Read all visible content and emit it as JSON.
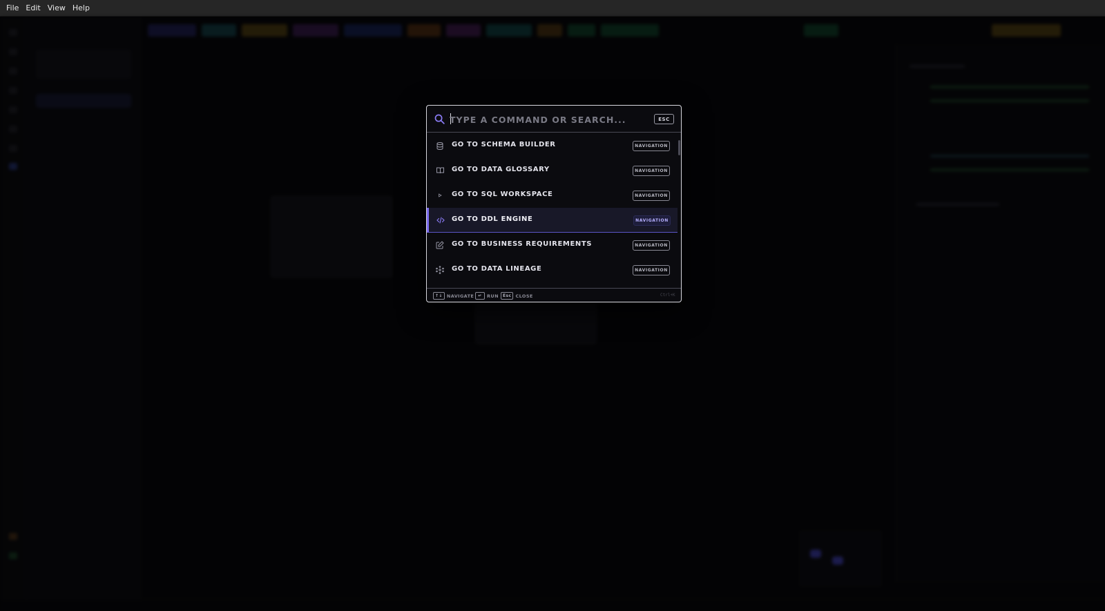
{
  "menubar": {
    "items": [
      "File",
      "Edit",
      "View",
      "Help"
    ]
  },
  "palette": {
    "search_placeholder": "TYPE A COMMAND OR SEARCH...",
    "search_value": "",
    "esc_label": "ESC",
    "active_index": 3,
    "items": [
      {
        "label": "GO TO SCHEMA BUILDER",
        "category": "NAVIGATION",
        "icon": "database-icon"
      },
      {
        "label": "GO TO DATA GLOSSARY",
        "category": "NAVIGATION",
        "icon": "book-icon"
      },
      {
        "label": "GO TO SQL WORKSPACE",
        "category": "NAVIGATION",
        "icon": "play-icon"
      },
      {
        "label": "GO TO DDL ENGINE",
        "category": "NAVIGATION",
        "icon": "code-icon"
      },
      {
        "label": "GO TO BUSINESS REQUIREMENTS",
        "category": "NAVIGATION",
        "icon": "edit-icon"
      },
      {
        "label": "GO TO DATA LINEAGE",
        "category": "NAVIGATION",
        "icon": "lineage-icon"
      }
    ],
    "footer": {
      "navigate_key": "↑↓",
      "navigate_label": "NAVIGATE",
      "run_key": "↵",
      "run_label": "RUN",
      "close_key": "Esc",
      "close_label": "CLOSE",
      "shortcut": "Ctrl+K"
    }
  },
  "colors": {
    "accent": "#7c6cf0",
    "background": "#050507",
    "palette_bg": "#0b0b0f"
  }
}
